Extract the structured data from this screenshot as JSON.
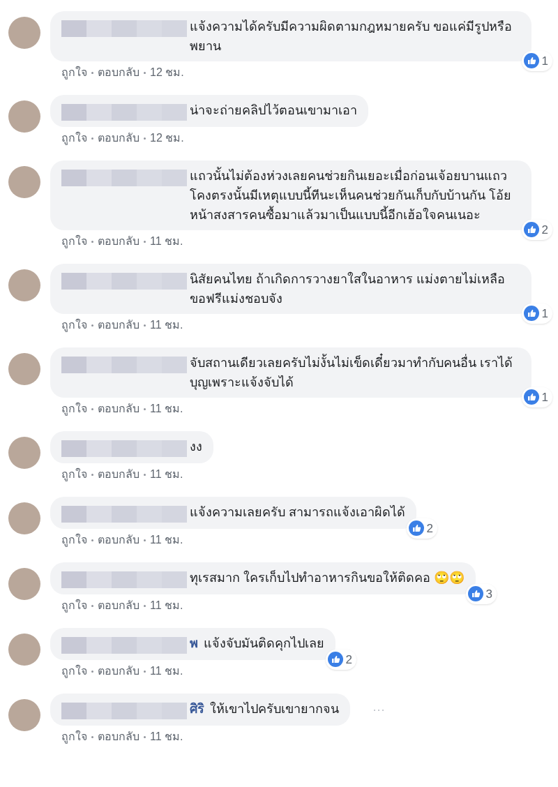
{
  "comments": [
    {
      "text": "แจ้งความได้ครับมีความผิดตามกฎหมายครับ ขอแค่มีรูปหรือพยาน",
      "likes": "1",
      "actions": [
        "ถูกใจ",
        "ตอบกลับ",
        "12 ชม."
      ]
    },
    {
      "text": "น่าจะถ่ายคลิปไว้ตอนเขามาเอา",
      "actions": [
        "ถูกใจ",
        "ตอบกลับ",
        "12 ชม."
      ]
    },
    {
      "text": "แถวนั้นไม่ต้องห่วงเลยคนช่วยกินเยอะเมื่อก่อนเจ้อยบานแถวโคงตรงนั้นมีเหตุแบบนี้ทีนะเห็นคนช่วยกันเก็บกับบ้านกัน โอ้ยหน้าสงสารคนซื้อมาแล้วมาเป็นแบบนี้อีกเฮ้อใจคนเนอะ",
      "likes": "2",
      "actions": [
        "ถูกใจ",
        "ตอบกลับ",
        "11 ชม."
      ]
    },
    {
      "text": "นิสัยคนไทย ถ้าเกิดการวางยาใสในอาหาร แม่งตายไม่เหลือ ขอฟรีแม่งชอบจัง",
      "likes": "1",
      "actions": [
        "ถูกใจ",
        "ตอบกลับ",
        "11 ชม."
      ]
    },
    {
      "text": "จับสถานเดียวเลยครับไม่งั้นไม่เข็ดเดี๋ยวมาทำกับคนอื่น เราได้บุญเพราะแจ้งจับได้",
      "likes": "1",
      "actions": [
        "ถูกใจ",
        "ตอบกลับ",
        "11 ชม."
      ]
    },
    {
      "text": "งง",
      "actions": [
        "ถูกใจ",
        "ตอบกลับ",
        "11 ชม."
      ]
    },
    {
      "text": "แจ้งความเลยครับ สามารถแจ้งเอาผิดได้",
      "likes": "2",
      "actions": [
        "ถูกใจ",
        "ตอบกลับ",
        "11 ชม."
      ]
    },
    {
      "text": "ทุเรสมาก ใครเก็บไปทำอาหารกินขอให้ติดคอ 🙄🙄",
      "likes": "3",
      "actions": [
        "ถูกใจ",
        "ตอบกลับ",
        "11 ชม."
      ]
    },
    {
      "name_tail": "พ",
      "text": "แจ้งจับมันติดคุกไปเลย",
      "likes": "2",
      "actions": [
        "ถูกใจ",
        "ตอบกลับ",
        "11 ชม."
      ]
    },
    {
      "name_tail": "ศิริ",
      "text": "ให้เขาไปครับเขายากจน",
      "more": "···",
      "actions": [
        "ถูกใจ",
        "ตอบกลับ",
        "11 ชม."
      ]
    }
  ]
}
